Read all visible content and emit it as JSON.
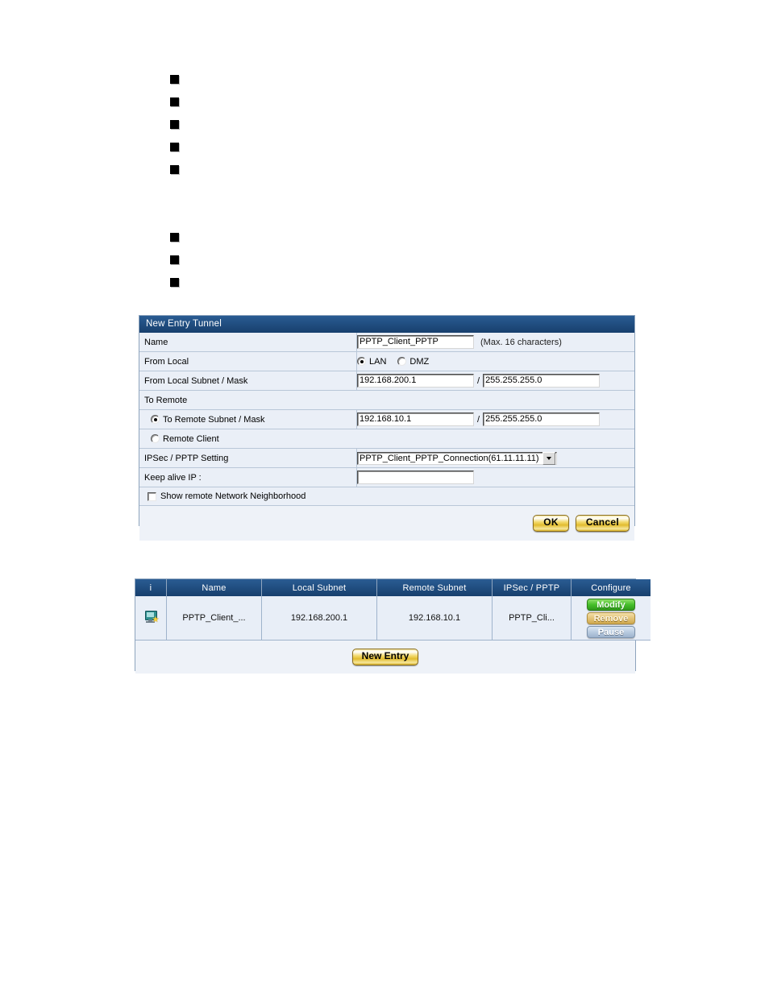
{
  "bullet_list": {
    "group_one_count": 5,
    "group_two_count": 3
  },
  "tunnel_form": {
    "title": "New Entry Tunnel",
    "rows": {
      "name": {
        "label": "Name",
        "value": "PPTP_Client_PPTP",
        "placeholder": "",
        "hint": "(Max. 16 characters)"
      },
      "from_local": {
        "label": "From Local",
        "options": [
          {
            "label": "LAN",
            "selected": true
          },
          {
            "label": "DMZ",
            "selected": false
          }
        ]
      },
      "from_local_subnet": {
        "label": "From Local Subnet / Mask",
        "subnet": "192.168.200.1",
        "separator": "/",
        "mask": "255.255.255.0"
      },
      "to_remote": {
        "label": "To Remote"
      },
      "to_remote_subnet": {
        "label": "To Remote Subnet / Mask",
        "selected": true,
        "subnet": "192.168.10.1",
        "separator": "/",
        "mask": "255.255.255.0"
      },
      "remote_client": {
        "label": "Remote Client",
        "selected": false
      },
      "ipsec_pptp_setting": {
        "label": "IPSec / PPTP Setting",
        "selected_option": "PPTP_Client_PPTP_Connection(61.11.11.11)"
      },
      "keep_alive_ip": {
        "label": "Keep alive IP :",
        "value": "",
        "placeholder": ""
      },
      "show_remote_neighborhood": {
        "label": "Show remote Network Neighborhood",
        "checked": false
      }
    },
    "buttons": {
      "ok": "OK",
      "cancel": "Cancel"
    }
  },
  "tunnel_table": {
    "headers": [
      "i",
      "Name",
      "Local Subnet",
      "Remote Subnet",
      "IPSec / PPTP",
      "Configure"
    ],
    "rows": [
      {
        "icon": "computer-star-icon",
        "name": "PPTP_Client_...",
        "local_subnet": "192.168.200.1",
        "remote_subnet": "192.168.10.1",
        "ipsec_pptp": "PPTP_Cli...",
        "configure": {
          "modify": "Modify",
          "remove": "Remove",
          "pause": "Pause"
        }
      }
    ],
    "footer_button": "New Entry"
  },
  "colors": {
    "title_bar": "#1f4e82",
    "panel_bg": "#eef2f8",
    "row_bg": "#eaeff7",
    "gold_button": "#e2bc2f",
    "modify_green": "#46bf2a",
    "remove_tan": "#e3c478",
    "pause_blue": "#b9cbe0"
  }
}
